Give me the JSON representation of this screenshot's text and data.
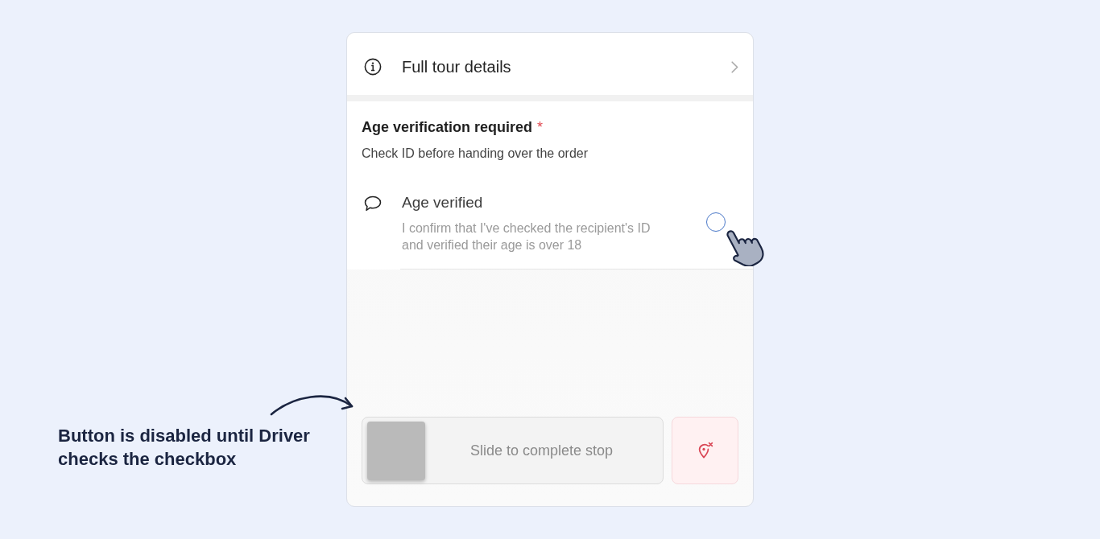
{
  "annotation": {
    "text": "Button is disabled until Driver checks the checkbox"
  },
  "details_link": {
    "label": "Full tour details"
  },
  "age_verification": {
    "title": "Age verification required",
    "required_mark": "*",
    "subtitle": "Check ID before handing over the order",
    "confirmation": {
      "label": "Age verified",
      "description": "I confirm that I've checked the recipient's ID and verified their age is over 18",
      "checked": false
    }
  },
  "complete_slider": {
    "label": "Slide to complete stop",
    "disabled": true
  }
}
